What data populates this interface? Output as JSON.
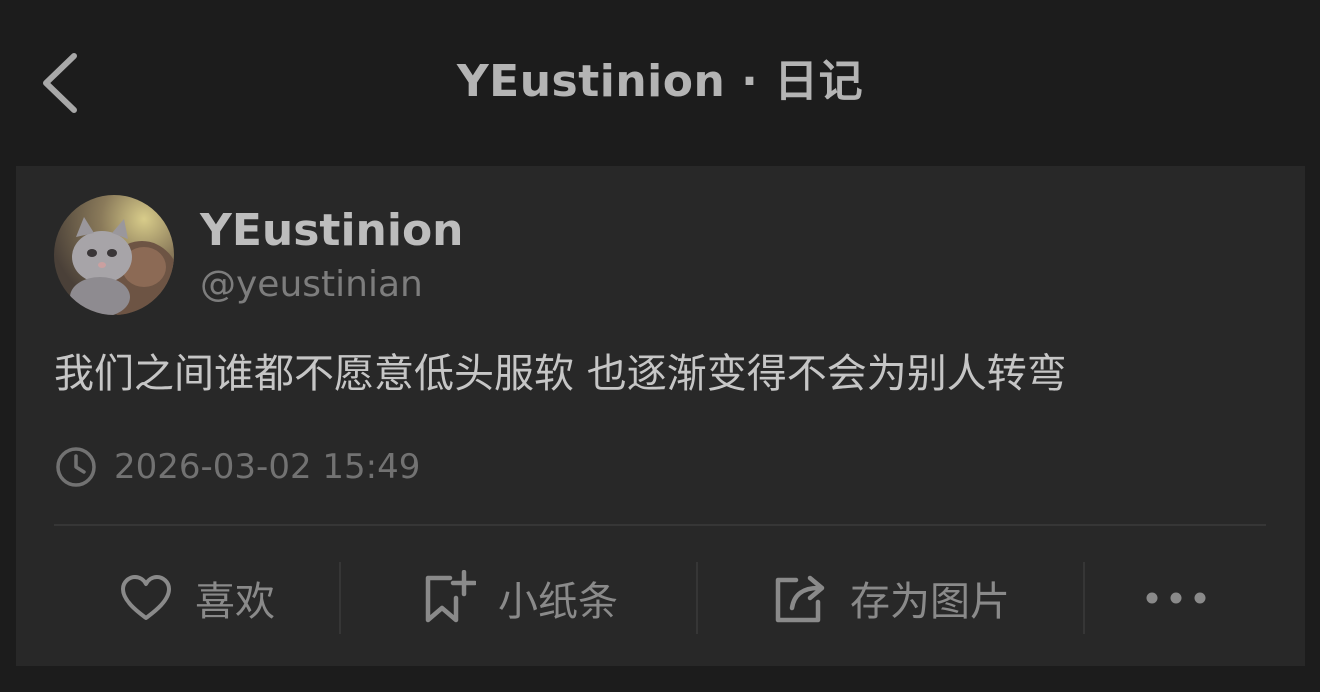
{
  "header": {
    "title": "YEustinion · 日记"
  },
  "post": {
    "author_name": "YEustinion",
    "author_handle": "@yeustinian",
    "text": "我们之间谁都不愿意低头服软 也逐渐变得不会为别人转弯",
    "timestamp": "2026-03-02 15:49"
  },
  "actions": {
    "like_label": "喜欢",
    "note_label": "小纸条",
    "save_image_label": "存为图片"
  },
  "icons": {
    "back": "chevron-left-icon",
    "clock": "clock-icon",
    "like": "heart-icon",
    "note": "bookmark-plus-icon",
    "save_image": "share-icon",
    "more": "more-dots-icon"
  },
  "colors": {
    "background": "#1c1c1c",
    "card": "#282828",
    "title_text": "#b4b4b4",
    "body_text": "#c6c6c6",
    "muted_text": "#7d7d7d"
  }
}
